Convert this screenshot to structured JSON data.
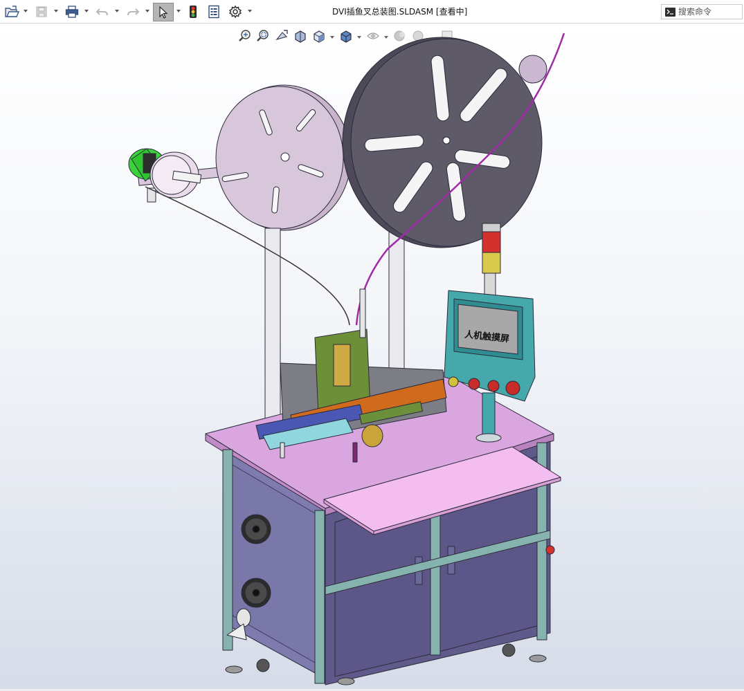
{
  "window": {
    "document_title": "DVI插鱼叉总装图.SLDASM [查看中]"
  },
  "toolbar": {
    "open_icon": "open-folder-icon",
    "save_icon": "save-disk-icon",
    "print_icon": "printer-icon",
    "undo_icon": "undo-arrow-icon",
    "redo_icon": "redo-arrow-icon",
    "select_icon": "select-pointer-icon",
    "rebuild_icon": "traffic-light-icon",
    "file_properties_icon": "file-properties-icon",
    "options_icon": "gear-icon"
  },
  "search": {
    "placeholder": "搜索命令"
  },
  "heads_up_toolbar": {
    "items": [
      "zoom-to-fit-icon",
      "zoom-to-area-icon",
      "previous-view-icon",
      "section-view-icon",
      "view-orientation-icon",
      "display-style-icon",
      "hide-show-items-icon",
      "edit-appearance-icon",
      "apply-scene-icon",
      "view-settings-icon"
    ]
  },
  "model": {
    "hmi_screen_text": "人机触摸屏",
    "colors": {
      "cabinet": "#7e7cae",
      "cabinet_front": "#605a8a",
      "frame": "#86b3ad",
      "table_top": "#d9a6df",
      "shelf": "#f4bdf0",
      "reel_large": "#5e5a68",
      "reel_small": "#d6c2d8",
      "motor": "#3ad43a",
      "hmi_body": "#45a8ab",
      "hmi_screen": "#a8a8a8",
      "tower_red": "#d2312d",
      "tower_yellow": "#d8c84c",
      "conveyor": "#d06b1e"
    }
  }
}
